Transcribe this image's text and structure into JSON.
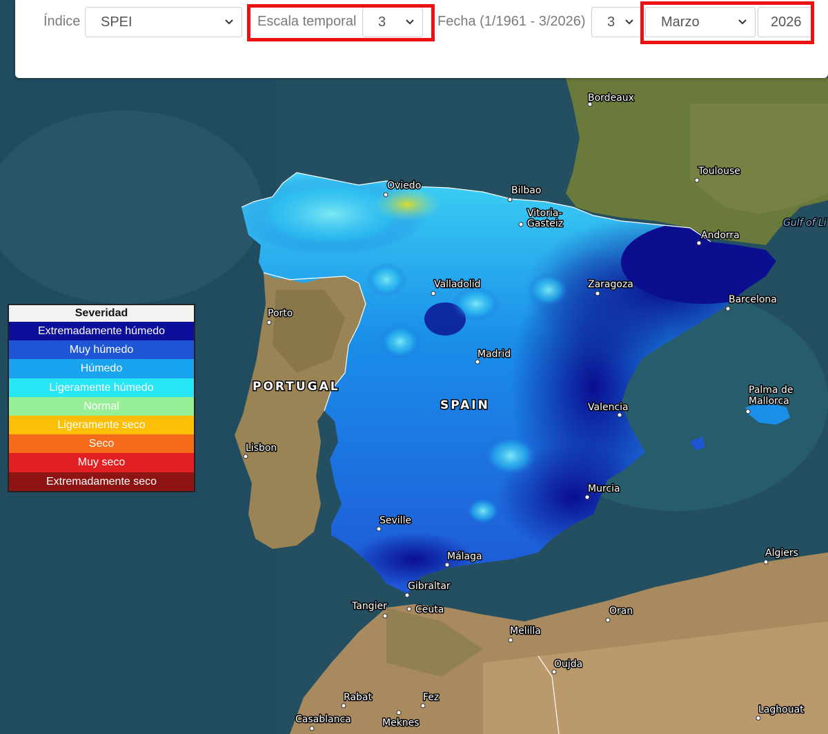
{
  "toolbar": {
    "index_label": "Índice",
    "index_value": "SPEI",
    "scale_label": "Escala temporal",
    "scale_value": "3",
    "date_label": "Fecha (1/1961 - 3/2026)",
    "day_value": "3",
    "month_value": "Marzo",
    "year_value": "2026",
    "highlight_color": "#ee1111"
  },
  "legend": {
    "title": "Severidad",
    "items": [
      {
        "label": "Extremadamente húmedo",
        "color": "#0b0f9a"
      },
      {
        "label": "Muy húmedo",
        "color": "#1f56d6"
      },
      {
        "label": "Húmedo",
        "color": "#1aa3ee"
      },
      {
        "label": "Ligeramente húmedo",
        "color": "#27e6f6"
      },
      {
        "label": "Normal",
        "color": "#97ef97"
      },
      {
        "label": "Ligeramente seco",
        "color": "#fcbf06"
      },
      {
        "label": "Seco",
        "color": "#f46b1a"
      },
      {
        "label": "Muy seco",
        "color": "#e21f22"
      },
      {
        "label": "Extremadamente seco",
        "color": "#8e1414"
      }
    ]
  },
  "map": {
    "countries": {
      "portugal": "PORTUGAL",
      "spain": "SPAIN"
    },
    "gulf": "Gulf of Li",
    "cities": {
      "bordeaux": "Bordeaux",
      "toulouse": "Toulouse",
      "andorra": "Andorra",
      "oviedo": "Oviedo",
      "bilbao": "Bilbao",
      "vitoria1": "Vitoria-",
      "vitoria2": "Gasteiz",
      "valladolid": "Valladolid",
      "zaragoza": "Zaragoza",
      "barcelona": "Barcelona",
      "porto": "Porto",
      "madrid": "Madrid",
      "valencia": "Valencia",
      "palma1": "Palma de",
      "palma2": "Mallorca",
      "lisbon": "Lisbon",
      "murcia": "Murcia",
      "seville": "Seville",
      "malaga": "Málaga",
      "gibraltar": "Gibraltar",
      "tangier": "Tangier",
      "ceuta": "Ceuta",
      "algiers": "Algiers",
      "oran": "Oran",
      "melilla": "Melilla",
      "oujda": "Oujda",
      "rabat": "Rabat",
      "fez": "Fez",
      "casablanca": "Casablanca",
      "meknes": "Meknes",
      "laghouat": "Laghouat"
    }
  }
}
